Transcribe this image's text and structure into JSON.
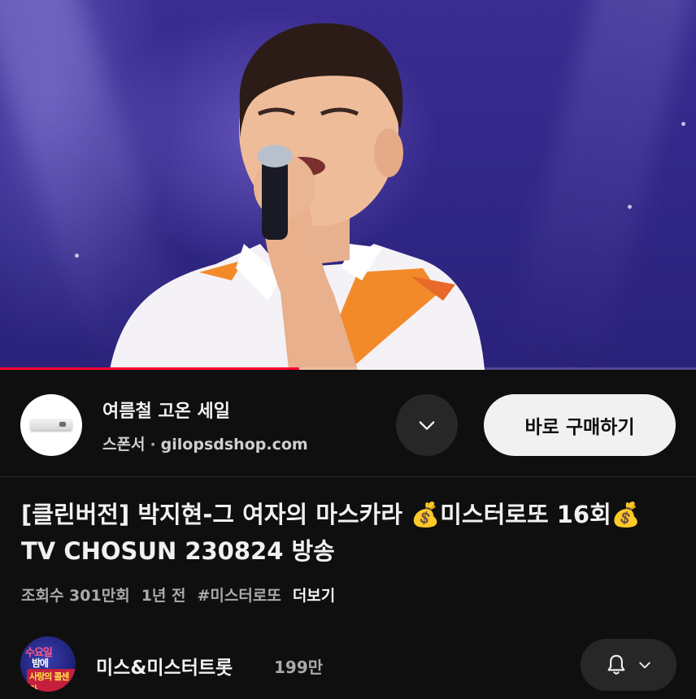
{
  "player": {
    "progress_fraction": 0.43
  },
  "ad": {
    "title": "여름철 고온 세일",
    "sponsor_label": "스폰서",
    "separator": "·",
    "domain": "gilopsdshop.com",
    "cta_label": "바로 구매하기",
    "expand_icon": "chevron-down-icon"
  },
  "video": {
    "title": "[클린버전] 박지현-그 여자의 마스카라 💰미스터로또 16회💰 TV CHOSUN 230824 방송",
    "views": "조회수 301만회",
    "age": "1년 전",
    "hashtag": "#미스터로또",
    "more_label": "더보기"
  },
  "channel": {
    "name": "미스&미스터트롯",
    "subscribers": "199만",
    "avatar_text": {
      "line1": "수요일",
      "line2": "밤에",
      "line3": "사랑의 콜센타"
    },
    "bell_icon": "bell-icon",
    "chevron_icon": "chevron-down-icon"
  },
  "colors": {
    "background": "#0f0f0f",
    "progress": "#ff0033",
    "button_dark": "#272727",
    "button_light": "#f1f1f1"
  }
}
